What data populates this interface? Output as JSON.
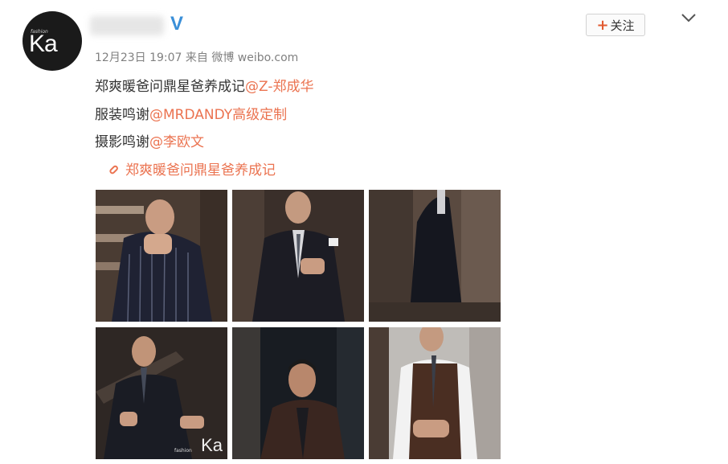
{
  "post": {
    "avatar_caption": "fashion",
    "avatar_logo": "Ka",
    "verified_mark": "V",
    "follow_label": "关注",
    "follow_plus": "+",
    "meta": "12月23日 19:07 来自 微博 weibo.com",
    "line1_text": "郑爽暖爸问鼎星爸养成记",
    "line1_mention": "@Z-郑成华",
    "line2_text": "服装鸣谢",
    "line2_mention": "@MRDANDY高级定制",
    "line3_text": "摄影鸣谢",
    "line3_mention": "@李欧文",
    "link_text": "郑爽暖爸问鼎星爸养成记",
    "watermark": "Ka"
  },
  "colors": {
    "mention": "#eb7350",
    "verified": "#3a8fd8",
    "meta": "#808080"
  },
  "icons": [
    "verified-icon",
    "chevron-down-icon",
    "link-icon",
    "plus-icon"
  ]
}
